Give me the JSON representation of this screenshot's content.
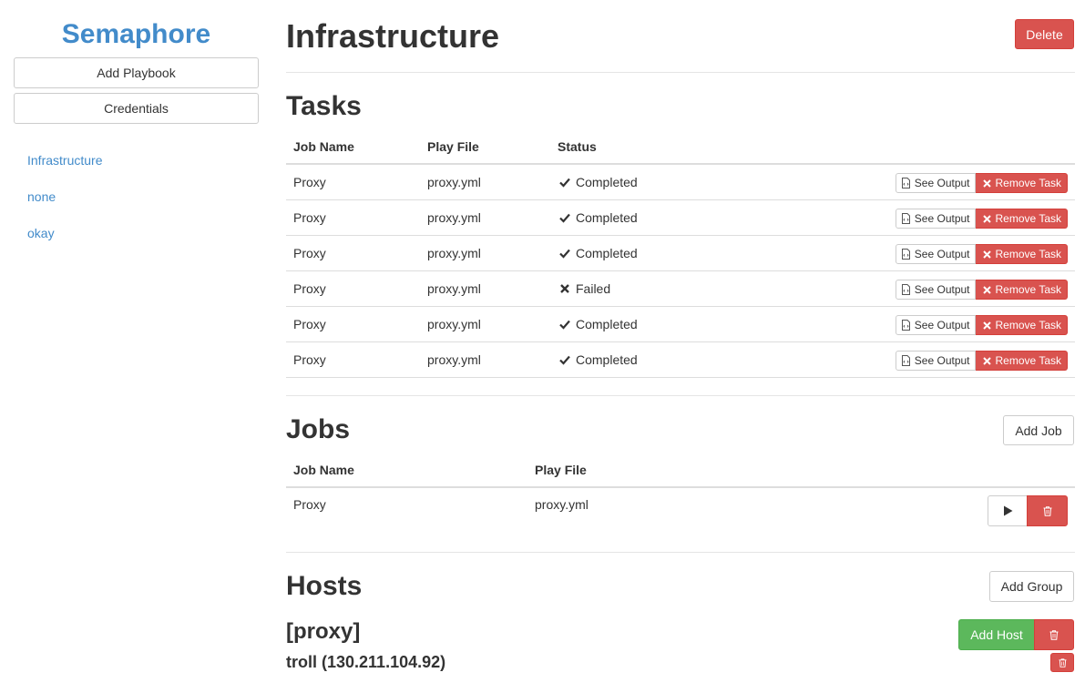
{
  "sidebar": {
    "brand": "Semaphore",
    "add_playbook_label": "Add Playbook",
    "credentials_label": "Credentials",
    "nav_items": [
      "Infrastructure",
      "none",
      "okay"
    ]
  },
  "header": {
    "title": "Infrastructure",
    "delete_label": "Delete"
  },
  "tasks": {
    "title": "Tasks",
    "columns": [
      "Job Name",
      "Play File",
      "Status"
    ],
    "rows": [
      {
        "job_name": "Proxy",
        "play_file": "proxy.yml",
        "status": "Completed",
        "status_icon": "check-icon"
      },
      {
        "job_name": "Proxy",
        "play_file": "proxy.yml",
        "status": "Completed",
        "status_icon": "check-icon"
      },
      {
        "job_name": "Proxy",
        "play_file": "proxy.yml",
        "status": "Completed",
        "status_icon": "check-icon"
      },
      {
        "job_name": "Proxy",
        "play_file": "proxy.yml",
        "status": "Failed",
        "status_icon": "x-icon"
      },
      {
        "job_name": "Proxy",
        "play_file": "proxy.yml",
        "status": "Completed",
        "status_icon": "check-icon"
      },
      {
        "job_name": "Proxy",
        "play_file": "proxy.yml",
        "status": "Completed",
        "status_icon": "check-icon"
      }
    ],
    "see_output_label": "See Output",
    "remove_task_label": "Remove Task"
  },
  "jobs": {
    "title": "Jobs",
    "add_job_label": "Add Job",
    "columns": [
      "Job Name",
      "Play File"
    ],
    "rows": [
      {
        "job_name": "Proxy",
        "play_file": "proxy.yml"
      }
    ]
  },
  "hosts": {
    "title": "Hosts",
    "add_group_label": "Add Group",
    "group_name": "[proxy]",
    "add_host_label": "Add Host",
    "host": "troll (130.211.104.92)"
  },
  "colors": {
    "brand": "#428bca",
    "danger": "#d9534f",
    "success": "#5cb85c"
  }
}
